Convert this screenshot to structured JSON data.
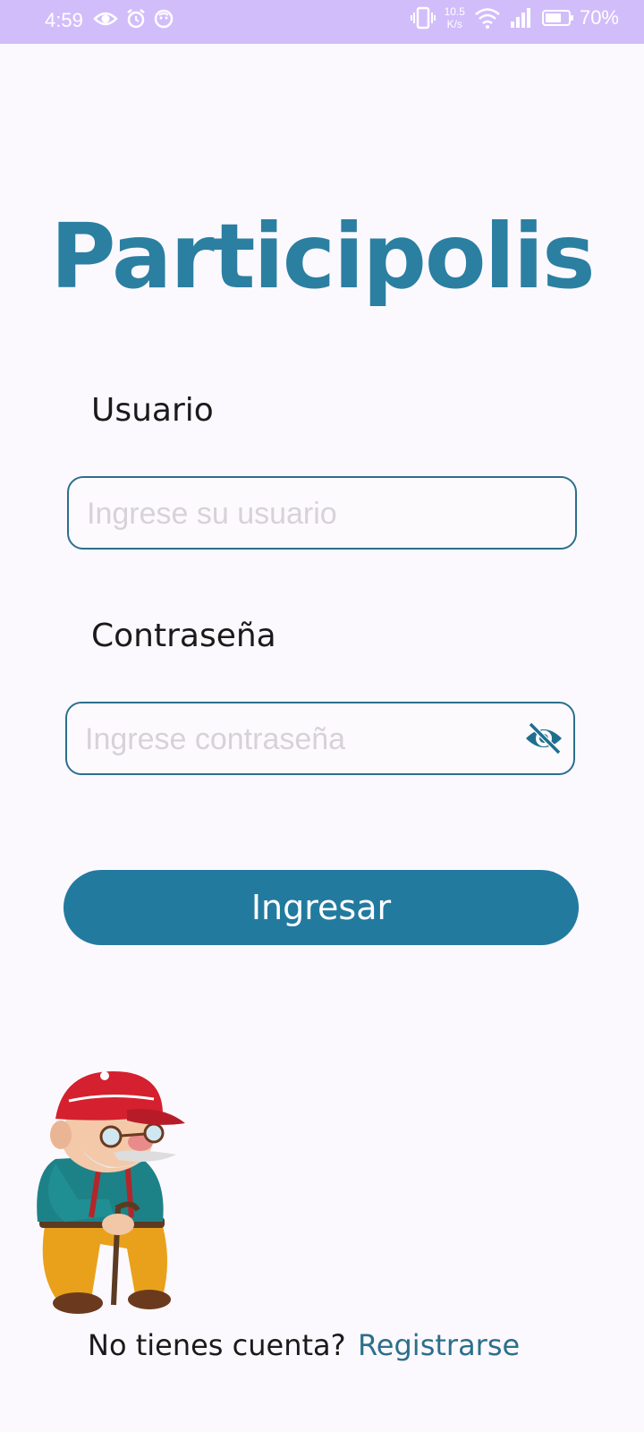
{
  "status_bar": {
    "time": "4:59",
    "net_speed_value": "10.5",
    "net_speed_unit": "K/s",
    "battery": "70%",
    "battery_level": 0.7,
    "icons": [
      "eye-icon",
      "alarm-icon",
      "app-icon",
      "vibrate-icon",
      "wifi-icon",
      "signal-icon",
      "battery-icon"
    ]
  },
  "app": {
    "title": "Participolis",
    "title_color": "#2b7fa1"
  },
  "form": {
    "username_label": "Usuario",
    "username_placeholder": "Ingrese su usuario",
    "password_label": "Contraseña",
    "password_placeholder": "Ingrese contraseña",
    "password_toggle_icon": "eye-off-icon",
    "submit_label": "Ingresar",
    "accent_color": "#227a9f"
  },
  "footer": {
    "question": "No tienes cuenta?",
    "register_link": "Registrarse"
  },
  "mascot": {
    "icon": "old-man-mascot-icon"
  }
}
